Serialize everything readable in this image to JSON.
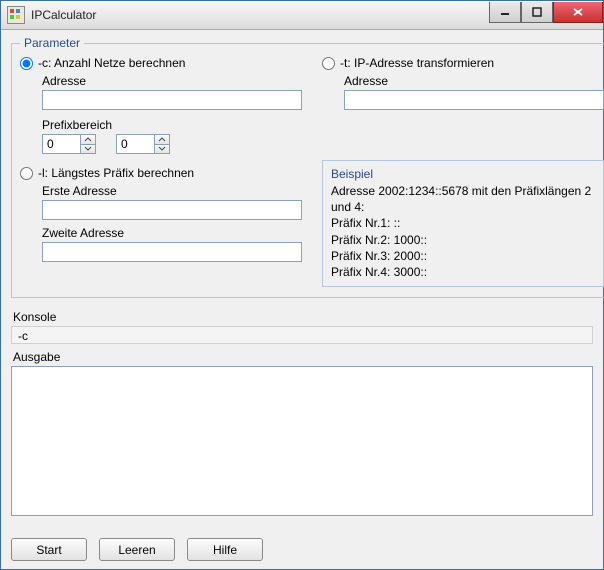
{
  "window": {
    "title": "IPCalculator"
  },
  "parameter": {
    "legend": "Parameter",
    "optC": {
      "label": "-c: Anzahl Netze berechnen",
      "checked": true,
      "adresseLabel": "Adresse",
      "adresseValue": "",
      "prefixLabel": "Prefixbereich",
      "prefixFrom": "0",
      "prefixTo": "0"
    },
    "optL": {
      "label": "-l: Längstes Präfix berechnen",
      "checked": false,
      "firstLabel": "Erste Adresse",
      "firstValue": "",
      "secondLabel": "Zweite Adresse",
      "secondValue": ""
    },
    "optT": {
      "label": "-t: IP-Adresse transformieren",
      "checked": false,
      "adresseLabel": "Adresse",
      "adresseValue": ""
    },
    "example": {
      "title": "Beispiel",
      "line1": "Adresse 2002:1234::5678 mit den Präfixlängen 2 und 4:",
      "line2": "",
      "line3": "Präfix Nr.1: ::",
      "line4": "Präfix Nr.2: 1000::",
      "line5": "Präfix Nr.3: 2000::",
      "line6": "Präfix Nr.4: 3000::"
    }
  },
  "konsole": {
    "label": "Konsole",
    "value": "-c"
  },
  "ausgabe": {
    "label": "Ausgabe",
    "value": ""
  },
  "buttons": {
    "start": "Start",
    "leeren": "Leeren",
    "hilfe": "Hilfe"
  }
}
